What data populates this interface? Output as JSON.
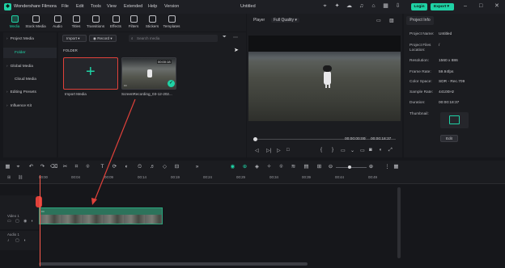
{
  "app": {
    "title": "Wondershare Filmora",
    "document_title": "Untitled",
    "menu": [
      "File",
      "Edit",
      "Tools",
      "View",
      "Extended",
      "Help",
      "Version"
    ],
    "login_label": "Login",
    "export_label": "Export"
  },
  "media_tabs": [
    {
      "label": "Media",
      "icon": "media-icon",
      "active": true
    },
    {
      "label": "Stock Media",
      "icon": "stock-media-icon"
    },
    {
      "label": "Audio",
      "icon": "music-note-icon"
    },
    {
      "label": "Titles",
      "icon": "text-t-icon"
    },
    {
      "label": "Transitions",
      "icon": "transition-icon"
    },
    {
      "label": "Effects",
      "icon": "sparkle-icon"
    },
    {
      "label": "Filters",
      "icon": "filter-icon"
    },
    {
      "label": "Stickers",
      "icon": "sticker-icon"
    },
    {
      "label": "Templates",
      "icon": "template-icon"
    }
  ],
  "sidebar": {
    "items": [
      {
        "label": "Project Media",
        "head": true
      },
      {
        "label": "Folder",
        "selected": true
      },
      {
        "label": "Global Media",
        "head": true
      },
      {
        "label": "Cloud Media",
        "head": false
      },
      {
        "label": "Editing Presets",
        "head": true
      },
      {
        "label": "Influence Kit",
        "head": true
      }
    ]
  },
  "media": {
    "import_dropdown": "Import",
    "record_dropdown": "Record",
    "search_placeholder": "Search media",
    "folder_label": "FOLDER",
    "import_tile_label": "Import Media",
    "clip_tile_label": "ScreenRecording_03-12-202...",
    "clip_duration": "00:00:18"
  },
  "player": {
    "label": "Player",
    "quality": "Full Quality",
    "current_time": "00:00:00:00",
    "total_time": "00:00:18:37"
  },
  "project_info": {
    "tab": "Project Info",
    "rows": [
      {
        "key": "Project Name:",
        "value": "Untitled"
      },
      {
        "key": "Project Files Location:",
        "value": "/"
      },
      {
        "key": "Resolution:",
        "value": "1560 x 886"
      },
      {
        "key": "Frame Rate:",
        "value": "59.94fps"
      },
      {
        "key": "Color Space:",
        "value": "SDR - Rec.709"
      },
      {
        "key": "Sample Rate:",
        "value": "44100Hz"
      },
      {
        "key": "Duration:",
        "value": "00:00:18:37"
      },
      {
        "key": "Thumbnail:",
        "value": ""
      }
    ],
    "edit_label": "Edit"
  },
  "timeline": {
    "ruler": [
      "00:00",
      "00:04",
      "00:09",
      "00:14",
      "00:19",
      "00:24",
      "00:29",
      "00:34",
      "00:39",
      "00:44",
      "00:49"
    ],
    "video_track_label": "Video 1",
    "audio_track_label": "Audio 1"
  },
  "colors": {
    "accent": "#1fd2a5",
    "playhead": "#ff5b4d",
    "annotation": "#e0413a"
  }
}
